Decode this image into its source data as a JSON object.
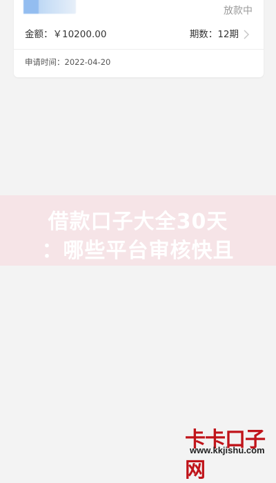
{
  "loan_card": {
    "status": "放款中",
    "amount_label": "金额：",
    "amount_value": "￥10200.00",
    "term_label": "期数：",
    "term_value": "12期",
    "apply_time_label": "申请时间：",
    "apply_time_value": "2022-04-20"
  },
  "banner": {
    "line1": "借款口子大全30天",
    "line2": "：哪些平台审核快且"
  },
  "watermark": {
    "logo": "卡卡口子网",
    "url": "www.kkjishu.com"
  },
  "colors": {
    "background": "#f3f3f3",
    "card": "#ffffff",
    "banner_bg": "#f6e4e7",
    "logo_red": "#c0141a"
  },
  "icons": {
    "card_avatar": "blurred-avatar-icon",
    "row_chevron": "chevron-right-icon"
  }
}
